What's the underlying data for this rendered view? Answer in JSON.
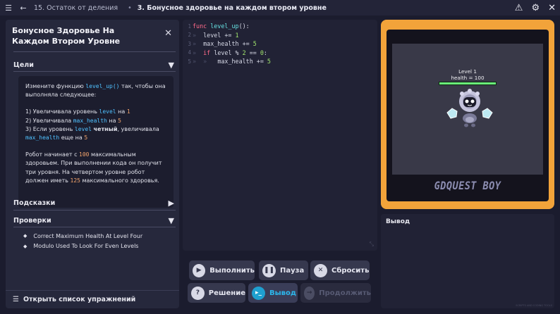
{
  "topbar": {
    "breadcrumb_parent": "15. Остаток от деления",
    "breadcrumb_current": "3. Бонусное здоровье на каждом втором уровне"
  },
  "panel": {
    "title": "Бонусное Здоровье На Каждом Втором Уровне",
    "goals_header": "Цели",
    "goals": {
      "intro_before": "Измените функцию ",
      "intro_code": "level_up()",
      "intro_after": " так, чтобы она выполняла следующее:",
      "item1_a": "1) Увеличивала уровень ",
      "item1_code": "level",
      "item1_b": " на ",
      "item1_num": "1",
      "item2_a": "2) Увеличивала ",
      "item2_code": "max_health",
      "item2_b": " на ",
      "item2_num": "5",
      "item3_a": "3) Если уровень ",
      "item3_code": "level",
      "item3_bold": "четный",
      "item3_b": ", увеличивала",
      "item3_code2": "max_health",
      "item3_c": " еще на ",
      "item3_num": "5",
      "para_a": "Робот начинает с ",
      "para_num1": "100",
      "para_b": " максимальным здоровьем. При выполнении кода он получит три уровня. На четвертом уровне робот должен иметь ",
      "para_num2": "125",
      "para_c": " максимального здоровья."
    },
    "hints_header": "Подсказки",
    "checks_header": "Проверки",
    "checks": [
      "Correct Maximum Health At Level Four",
      "Modulo Used To Look For Even Levels"
    ],
    "open_list": "Открыть список упражнений"
  },
  "editor": {
    "line_numbers": [
      "1",
      "2",
      "3",
      "4",
      "5"
    ],
    "line1": {
      "kw": "func",
      "fn": "level_up",
      "rest": "():"
    },
    "line2": {
      "text": "level += ",
      "num": "1"
    },
    "line3": {
      "text": "max_health += ",
      "num": "5"
    },
    "line4": {
      "kw": "if",
      "a": " level % ",
      "n1": "2",
      "b": " == ",
      "n2": "0",
      "c": ":"
    },
    "line5": {
      "text": "max_health += ",
      "num": "5"
    },
    "indent_mark": "»"
  },
  "buttons": {
    "run": "Выполнить",
    "pause": "Пауза",
    "reset": "Сбросить",
    "solution": "Решение",
    "output": "Вывод",
    "continue": "Продолжить"
  },
  "game": {
    "level_text": "Level 1",
    "health_text": "health = 100",
    "logo": "GDQUEST BOY"
  },
  "output": {
    "header": "Вывод"
  },
  "footer": "SCRIPTS AND CODING TOOLS",
  "colors": {
    "accent_orange": "#f2a33a",
    "health_green": "#6aeb7a",
    "keyword": "#ff6b8a",
    "number": "#a0e46c",
    "active_blue": "#1fa0d0"
  },
  "icons": {
    "menu": "menu-icon",
    "back": "back-arrow-icon",
    "warning": "warning-icon",
    "settings": "gear-icon",
    "close": "close-icon"
  }
}
